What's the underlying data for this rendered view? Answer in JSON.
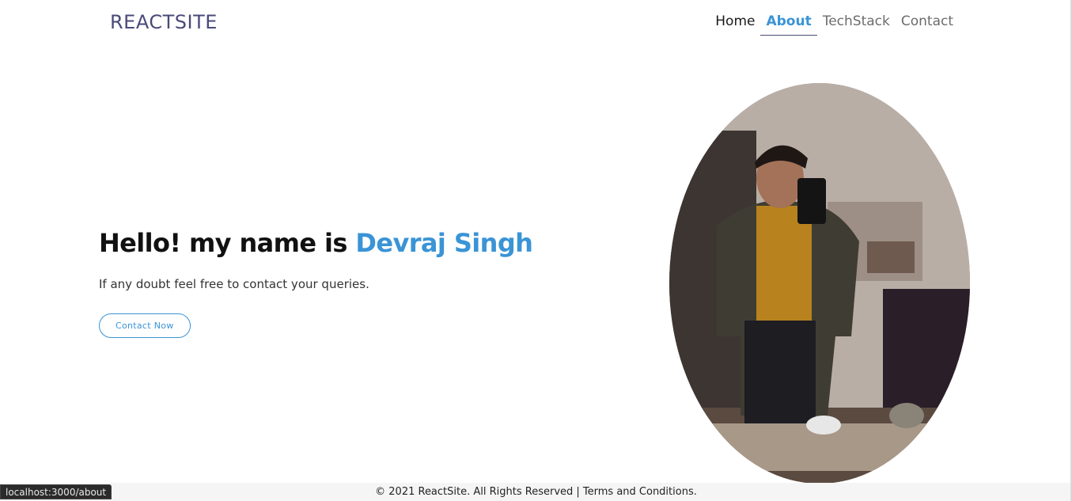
{
  "navbar": {
    "brand": "REACTSITE",
    "links": [
      {
        "label": "Home"
      },
      {
        "label": "About"
      },
      {
        "label": "TechStack"
      },
      {
        "label": "Contact"
      }
    ]
  },
  "hero": {
    "greeting": "Hello! my name is",
    "name": "Devraj Singh",
    "subtitle": "If any doubt feel free to contact your queries.",
    "button_label": "Contact Now"
  },
  "footer": {
    "text": "© 2021 ReactSite. All Rights Reserved | Terms and Conditions."
  },
  "statusbar": {
    "url": "localhost:3000/about"
  },
  "colors": {
    "accent": "#3a94d6",
    "brand": "#4a4a7a"
  }
}
